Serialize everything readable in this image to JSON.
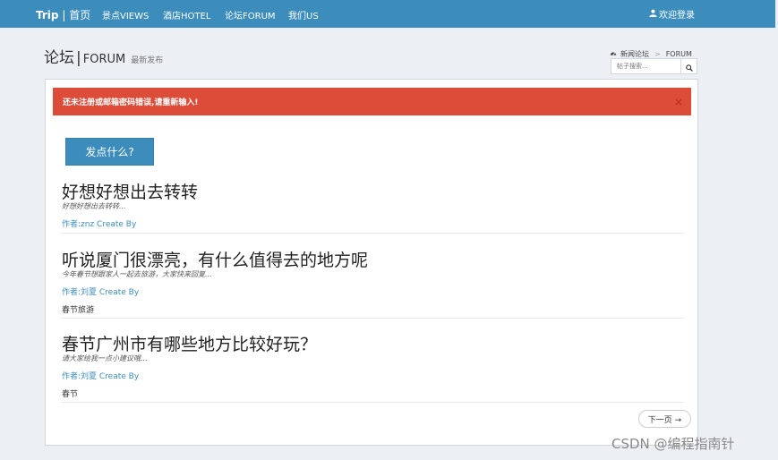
{
  "navbar": {
    "brand_name": "Trip",
    "brand_sep": "|",
    "brand_home": "首页",
    "items": [
      {
        "label": "景点VIEWS"
      },
      {
        "label": "酒店HOTEL"
      },
      {
        "label": "论坛FORUM"
      },
      {
        "label": "我们US"
      }
    ],
    "login_label": "欢迎登录",
    "login_icon": "user-icon"
  },
  "header": {
    "title": "论坛",
    "title_sep": "|",
    "subtitle": "FORUM",
    "small": "最新发布"
  },
  "breadcrumb": {
    "icon": "dashboard-icon",
    "home": "新闻论坛",
    "divider": ">",
    "current": "FORUM"
  },
  "search": {
    "placeholder": "帖子搜索...",
    "icon": "search-icon"
  },
  "alert": {
    "message": "还未注册或邮箱密码错误,请重新输入!",
    "close": "×"
  },
  "post_button": "发点什么?",
  "topics": [
    {
      "title": "好想好想出去转转",
      "desc": "好想好想出去转转...",
      "author": "作者:znz Create By",
      "tag": ""
    },
    {
      "title": "听说厦门很漂亮，有什么值得去的地方呢",
      "desc": "今年春节想跟家人一起去旅游，大家快来回复...",
      "author": "作者:刘夏 Create By",
      "tag": "春节旅游"
    },
    {
      "title": "春节广州市有哪些地方比较好玩？",
      "desc": "请大家给我一点小建议哦...",
      "author": "作者:刘夏 Create By",
      "tag": "春节"
    }
  ],
  "pager": {
    "next": "下一页 →"
  },
  "watermark": "CSDN @编程指南针",
  "colors": {
    "navbar": "#3c8dbc",
    "alert": "#dd4b39",
    "primary_button": "#3c8dbc",
    "background": "#ecf0f5"
  }
}
